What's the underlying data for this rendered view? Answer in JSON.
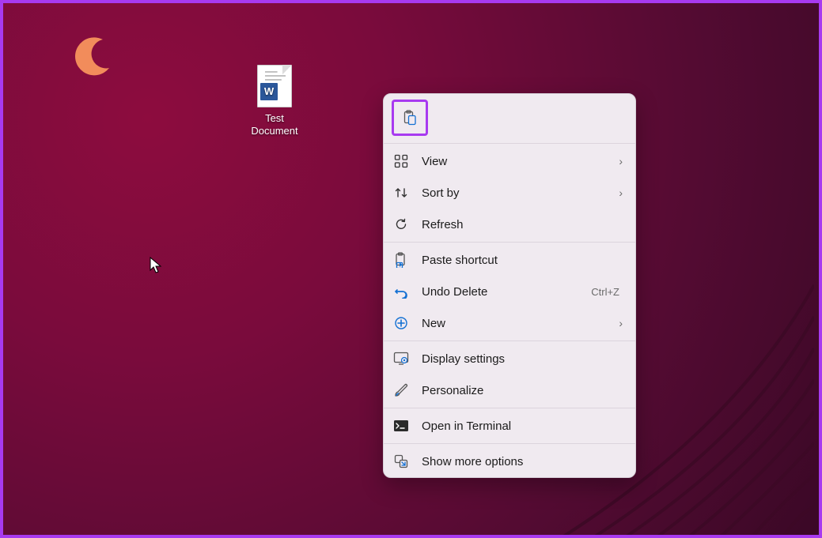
{
  "desktop": {
    "icons": [
      {
        "label": "Test\nDocument",
        "doc_badge": "W"
      }
    ]
  },
  "context_menu": {
    "top_buttons": [
      {
        "name": "paste-button"
      }
    ],
    "groups": [
      [
        {
          "label": "View",
          "icon": "grid-icon",
          "submenu": true
        },
        {
          "label": "Sort by",
          "icon": "sort-icon",
          "submenu": true
        },
        {
          "label": "Refresh",
          "icon": "refresh-icon"
        }
      ],
      [
        {
          "label": "Paste shortcut",
          "icon": "paste-shortcut-icon"
        },
        {
          "label": "Undo Delete",
          "icon": "undo-icon",
          "shortcut": "Ctrl+Z"
        },
        {
          "label": "New",
          "icon": "plus-icon",
          "submenu": true
        }
      ],
      [
        {
          "label": "Display settings",
          "icon": "display-settings-icon"
        },
        {
          "label": "Personalize",
          "icon": "personalize-icon"
        }
      ],
      [
        {
          "label": "Open in Terminal",
          "icon": "terminal-icon"
        }
      ],
      [
        {
          "label": "Show more options",
          "icon": "more-options-icon"
        }
      ]
    ]
  },
  "glyphs": {
    "chevron_right": "›"
  }
}
